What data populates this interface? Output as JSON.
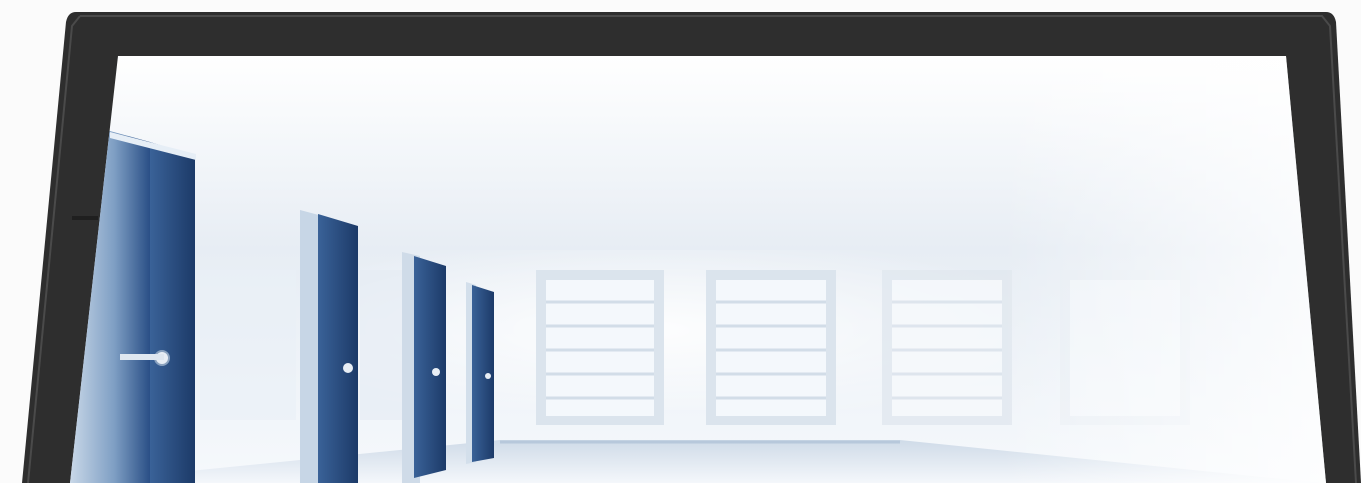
{
  "scene": {
    "subject": "monitor-frame-with-office-corridor-photo",
    "colors": {
      "page_background": "#fbfbfb",
      "bezel": "#2e2e2e",
      "bezel_edge": "#4a4a4a",
      "ceiling": "#eef3f8",
      "floor": "#dde8f2",
      "door_blue": "#2a4f86",
      "door_glass": "#a9bfd8",
      "window_frame": "#dbe4ed",
      "window_pane": "#f4f8fc"
    }
  }
}
